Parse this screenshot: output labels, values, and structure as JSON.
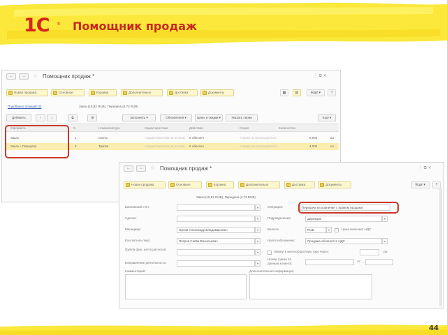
{
  "slide": {
    "logo": "1С",
    "logo_mark": "®",
    "title": "Помощник продаж",
    "page_number": "44"
  },
  "window1": {
    "title": "Помощник продаж *",
    "nav_back": "←",
    "nav_fwd": "→",
    "star": "☆",
    "win_controls": "⋮ ⧉ ✕",
    "tabs": [
      "Новая продажа",
      "Основное",
      "Корзина",
      "Дополнительно",
      "Доставка",
      "Документы"
    ],
    "more": "Еще ▾",
    "help": "?",
    "link_text": "Подобрано позиций (2)",
    "summary": "Заказ (15,92 RUB), Передача (4,72 RUB)",
    "toolbar": {
      "add": "Добавить",
      "fill": "Заполнить ▾",
      "update": "Обновления ▾",
      "prices": "Цены и скидки ▾",
      "series": "Указать серии",
      "more": "Еще ▾"
    },
    "columns": [
      "Оформить",
      "N",
      "Номенклатура",
      "Характеристика",
      "Действие",
      "Серия",
      "Количество"
    ],
    "rows": [
      {
        "action": "Заказ",
        "n": "1",
        "item": "Свеча",
        "characteristic": "<характеристики не используются>",
        "operation": "К обеспеч",
        "series": "<серии не используются>",
        "qty": "5,000",
        "unit": "шт"
      },
      {
        "action": "Заказ + Передача",
        "n": "2",
        "item": "Тряпка",
        "characteristic": "<характеристики не используются>",
        "operation": "К обеспеч",
        "series": "<серии не используются>",
        "qty": "4,000",
        "unit": "шт"
      }
    ]
  },
  "window2": {
    "title": "Помощник продаж *",
    "nav_back": "←",
    "nav_fwd": "→",
    "star": "☆",
    "win_controls": "⋮ ⧉ ✕",
    "tabs": [
      "Новая продажа",
      "Основное",
      "Корзина",
      "Дополнительно",
      "Доставка",
      "Документы"
    ],
    "more": "Еще ▾",
    "help": "?",
    "summary": "Заказ (15,92 RUB), Передача (4,72 RUB)",
    "left_fields": [
      {
        "label": "Банковский счет:",
        "value": ""
      },
      {
        "label": "Сделка:",
        "value": ""
      },
      {
        "label": "Менеджер:",
        "value": "Орлов Александр Владимирович"
      },
      {
        "label": "Контактное лицо:",
        "value": "Петров Савва Васильевич"
      },
      {
        "label": "Группа фин. учета расчетов:",
        "value": ""
      },
      {
        "label": "Направление деятельности:",
        "value": ""
      }
    ],
    "right_fields": {
      "operation_label": "Операция:",
      "operation_value": "Передача на хранение с правом продажи",
      "division_label": "Подразделение:",
      "division_value": "Дирекция",
      "currency_label": "Валюта:",
      "currency_value": "RUB",
      "price_vat": "Цена включает НДС",
      "tax_label": "Налогообложение:",
      "tax_value": "Продажа облагается НДС",
      "return_label": "Вернуть многооборотную тару через:",
      "return_unit": "дн.",
      "order_label": "Номер (закза по данным клиента:",
      "order_from": "от:"
    },
    "comment_label": "Комментарий:",
    "extra_label": "Дополнительная информация:"
  }
}
